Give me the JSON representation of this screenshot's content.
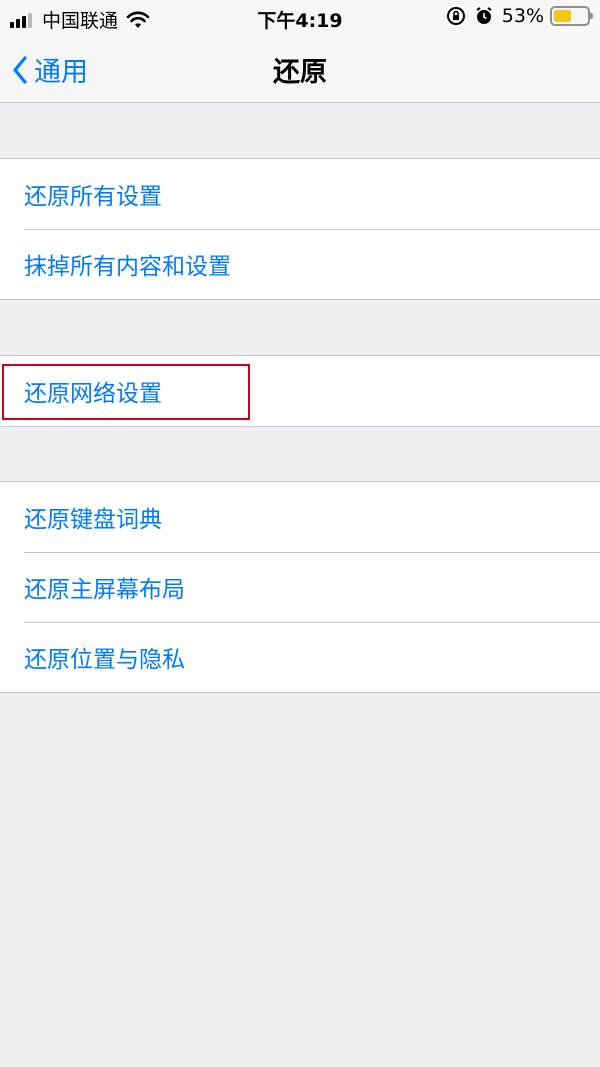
{
  "status_bar": {
    "carrier": "中国联通",
    "time": "下午4:19",
    "battery_percent": "53%",
    "battery_level": 0.53,
    "icons": [
      "signal-icon",
      "wifi-icon",
      "rotation-lock-icon",
      "alarm-icon",
      "battery-icon"
    ]
  },
  "nav": {
    "back_label": "通用",
    "title": "还原"
  },
  "groups": [
    {
      "items": [
        {
          "label": "还原所有设置"
        },
        {
          "label": "抹掉所有内容和设置"
        }
      ]
    },
    {
      "items": [
        {
          "label": "还原网络设置"
        }
      ]
    },
    {
      "items": [
        {
          "label": "还原键盘词典"
        },
        {
          "label": "还原主屏幕布局"
        },
        {
          "label": "还原位置与隐私"
        }
      ]
    }
  ],
  "colors": {
    "accent": "#007aff",
    "highlight_box": "#d0021b",
    "battery_fill": "#f5c518",
    "background": "#efeff4"
  }
}
